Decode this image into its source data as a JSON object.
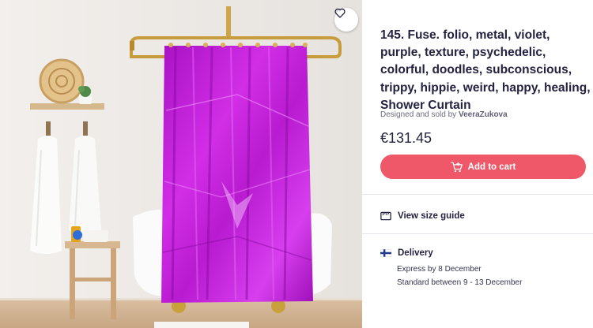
{
  "product": {
    "title": "145. Fuse. folio, metal, violet, purple, texture, psychedelic, colorful, doodles, subconscious, trippy, hippie, weird, happy, healing, Shower Curtain",
    "byline_prefix": "Designed and sold by",
    "artist": "VeeraZukova",
    "price": "€131.45",
    "favorite_icon": "heart-outline-icon"
  },
  "actions": {
    "add_to_cart": "Add to cart",
    "cart_icon": "cart-plus-icon"
  },
  "size_guide": {
    "label": "View size guide",
    "icon": "ruler-icon"
  },
  "delivery": {
    "heading": "Delivery",
    "flag_icon": "finland-flag-icon",
    "express": "Express by 8 December",
    "standard": "Standard between 9 - 13 December"
  },
  "colors": {
    "accent": "#ee5868",
    "curtain": "#c21bd6",
    "text": "#232341"
  }
}
